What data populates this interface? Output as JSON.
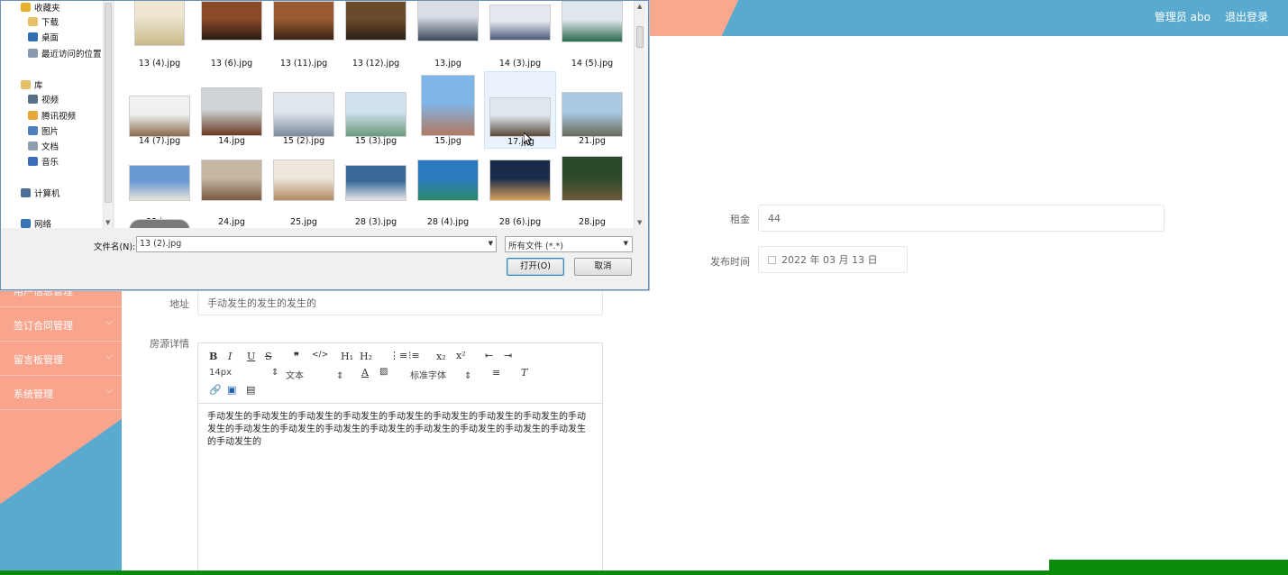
{
  "topbar": {
    "admin_label": "管理员 abo",
    "logout_label": "退出登录"
  },
  "sidebar": {
    "items": [
      {
        "label": "用户信息管理"
      },
      {
        "label": "签订合同管理"
      },
      {
        "label": "留言板管理"
      },
      {
        "label": "系统管理"
      }
    ]
  },
  "form": {
    "rent_label": "租金",
    "rent_value": "44",
    "publish_label": "发布时间",
    "publish_value": "2022 年 03 月 13 日",
    "address_label": "地址",
    "address_value": "手动发生的发生的发生的",
    "detail_label": "房源详情"
  },
  "editor": {
    "font_size": "14px",
    "text_type": "文本",
    "font_family": "标准字体",
    "content": "手动发生的手动发生的手动发生的手动发生的手动发生的手动发生的手动发生的手动发生的手动发生的手动发生的手动发生的手动发生的手动发生的手动发生的手动发生的手动发生的手动发生的手动发生的"
  },
  "dialog": {
    "nav": [
      {
        "label": "收藏夹",
        "icon": "star-icon",
        "color": "#e8b22c"
      },
      {
        "label": "下载",
        "icon": "download-folder-icon",
        "color": "#e6c069"
      },
      {
        "label": "桌面",
        "icon": "desktop-icon",
        "color": "#2f6fb2"
      },
      {
        "label": "最近访问的位置",
        "icon": "recent-places-icon",
        "color": "#8a9bb0"
      },
      {
        "label": "库",
        "icon": "library-icon",
        "color": "#e6c069"
      },
      {
        "label": "视频",
        "icon": "video-icon",
        "color": "#5a6f88"
      },
      {
        "label": "腾讯视频",
        "icon": "tencent-video-icon",
        "color": "#e6a93a"
      },
      {
        "label": "图片",
        "icon": "pictures-icon",
        "color": "#4f7fbf"
      },
      {
        "label": "文档",
        "icon": "documents-icon",
        "color": "#8f9fb0"
      },
      {
        "label": "音乐",
        "icon": "music-icon",
        "color": "#3c6cbc"
      },
      {
        "label": "计算机",
        "icon": "computer-icon",
        "color": "#4b6f98"
      },
      {
        "label": "网络",
        "icon": "network-icon",
        "color": "#3a74b8"
      }
    ],
    "files": [
      {
        "name": "13 (4).jpg",
        "c1": "#efe7d2",
        "c2": "#c9b98a"
      },
      {
        "name": "13 (6).jpg",
        "c1": "#8a4a28",
        "c2": "#2a1a12"
      },
      {
        "name": "13 (11).jpg",
        "c1": "#9a5a32",
        "c2": "#3a2416"
      },
      {
        "name": "13 (12).jpg",
        "c1": "#6a4a2a",
        "c2": "#2a2016"
      },
      {
        "name": "13.jpg",
        "c1": "#d8dde6",
        "c2": "#3a4a5a"
      },
      {
        "name": "14 (3).jpg",
        "c1": "#e6eaf0",
        "c2": "#4a5a78"
      },
      {
        "name": "14 (5).jpg",
        "c1": "#e0e6ee",
        "c2": "#2a6a4a"
      },
      {
        "name": "14 (7).jpg",
        "c1": "#eef0f2",
        "c2": "#8a6a4a"
      },
      {
        "name": "14.jpg",
        "c1": "#cfd4d8",
        "c2": "#6a3a22"
      },
      {
        "name": "15 (2).jpg",
        "c1": "#dfe6ee",
        "c2": "#7a8a9a"
      },
      {
        "name": "15 (3).jpg",
        "c1": "#cfe0ef",
        "c2": "#6a9a7a"
      },
      {
        "name": "15.jpg",
        "c1": "#7fb6e8",
        "c2": "#b07a62"
      },
      {
        "name": "17.jpg",
        "c1": "#dfe6ee",
        "c2": "#5a4a3a"
      },
      {
        "name": "21.jpg",
        "c1": "#a8c8e2",
        "c2": "#6a6a5a"
      },
      {
        "name": "22.jpg",
        "c1": "#6a9ad2",
        "c2": "#e6e2da"
      },
      {
        "name": "24.jpg",
        "c1": "#c6b6a2",
        "c2": "#7a5a42"
      },
      {
        "name": "25.jpg",
        "c1": "#efe6dc",
        "c2": "#b08a62"
      },
      {
        "name": "28 (3).jpg",
        "c1": "#3a6a9a",
        "c2": "#e6e6e6"
      },
      {
        "name": "28 (4).jpg",
        "c1": "#2a7ac0",
        "c2": "#2a8a6a"
      },
      {
        "name": "28 (6).jpg",
        "c1": "#1a2a4a",
        "c2": "#d8a25a"
      },
      {
        "name": "28.jpg",
        "c1": "#2a4a2a",
        "c2": "#6a5a3a"
      }
    ],
    "filename_label": "文件名(N):",
    "filename_value": "13 (2).jpg",
    "filetype_value": "所有文件 (*.*)",
    "open_label": "打开(O)",
    "cancel_label": "取消"
  }
}
